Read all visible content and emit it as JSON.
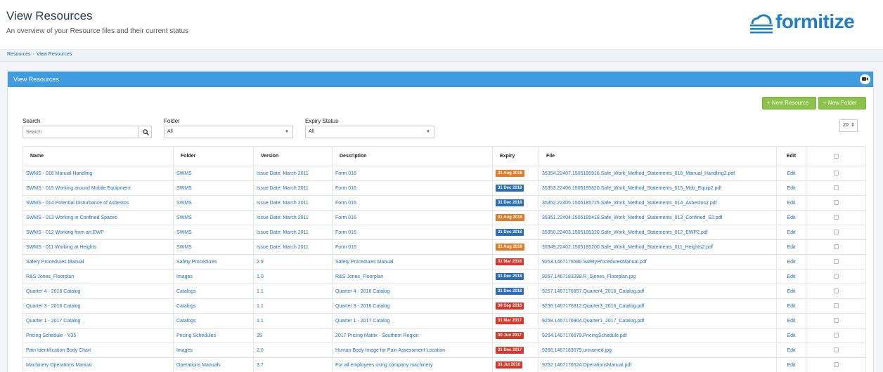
{
  "header": {
    "title": "View Resources",
    "subtitle": "An overview of your Resource files and their current status",
    "logo_text": "formitize"
  },
  "breadcrumb": [
    "Resources",
    "View Resources"
  ],
  "panel": {
    "title": "View Resources",
    "new_resource_label": "+ New Resource",
    "new_folder_label": "+ New Folder"
  },
  "filters": {
    "search_label": "Search",
    "search_placeholder": "Search",
    "folder_label": "Folder",
    "folder_value": "All",
    "expiry_label": "Expiry Status",
    "expiry_value": "All",
    "per_page": "20"
  },
  "colors": {
    "accent": "#3f9ce0",
    "green": "#8bc34a",
    "badge_blue": "#2a6ebb",
    "badge_orange": "#e07b28",
    "badge_red": "#d9372a"
  },
  "table": {
    "columns": [
      "Name",
      "Folder",
      "Version",
      "Description",
      "Expiry",
      "File",
      "Edit"
    ],
    "rows": [
      {
        "name": "SWMS - 016 Manual Handling",
        "folder": "SWMS",
        "version": "Issue Date: March 2011",
        "description": "Form 016",
        "expiry": "31 Aug 2018",
        "status": "orange",
        "file": "35354.22407.1505185916.Safe_Work_Method_Statements_016_Manual_Handling2.pdf",
        "edit": "Edit"
      },
      {
        "name": "SWMS - 015 Working around Mobile Equipment",
        "folder": "SWMS",
        "version": "Issue Date: March 2011",
        "description": "Form 016",
        "expiry": "31 Dec 2018",
        "status": "blue",
        "file": "35353.22406.1505185820.Safe_Work_Method_Statements_015_Mob_Equip2.pdf",
        "edit": "Edit"
      },
      {
        "name": "SWMS - 014 Potential Disturbance of Asbestos",
        "folder": "SWMS",
        "version": "Issue Date: March 2011",
        "description": "Form 016",
        "expiry": "31 Dec 2018",
        "status": "blue",
        "file": "35352.22405.1505185725.Safe_Work_Method_Statements_014_Asbestos2.pdf",
        "edit": "Edit"
      },
      {
        "name": "SWMS - 013 Working in Confined Spaces",
        "folder": "SWMS",
        "version": "Issue Date: March 2011",
        "description": "Form 016",
        "expiry": "31 Aug 2018",
        "status": "orange",
        "file": "35351.22404.1505185418.Safe_Work_Method_Statements_013_Confined_S2.pdf",
        "edit": "Edit"
      },
      {
        "name": "SWMS - 012 Working from an EWP",
        "folder": "SWMS",
        "version": "Issue Date: March 2011",
        "description": "Form 016",
        "expiry": "31 Dec 2018",
        "status": "blue",
        "file": "35350.22403.1505185320.Safe_Work_Method_Statements_012_EWP2.pdf",
        "edit": "Edit"
      },
      {
        "name": "SWMS - 011 Working at Heights",
        "folder": "SWMS",
        "version": "Issue Date: March 2011",
        "description": "Form 016",
        "expiry": "31 Aug 2018",
        "status": "orange",
        "file": "35349.22402.1505185200.Safe_Work_Method_Statements_011_Heights2.pdf",
        "edit": "Edit"
      },
      {
        "name": "Safety Procedures Manual",
        "folder": "Safety Procedures",
        "version": "2.9",
        "description": "Safety Procedures Manual",
        "expiry": "31 Mar 2018",
        "status": "red",
        "file": "9253.1467176580.SafetyProceduresManual.pdf",
        "edit": "Edit"
      },
      {
        "name": "R&S Jones_Floorplan",
        "folder": "Images",
        "version": "1.0",
        "description": "R&S Jones_Floorplan",
        "expiry": "31 Dec 2018",
        "status": "blue",
        "file": "9267.1467183299.R_Sjones_Floorplan.jpg",
        "edit": "Edit"
      },
      {
        "name": "Quarter 4 - 2016 Catalog",
        "folder": "Catalogs",
        "version": "1.1",
        "description": "Quarter 4 - 2016 Catalog",
        "expiry": "31 Dec 2018",
        "status": "blue",
        "file": "9257.1467176857.Quarter4_2016_Catalog.pdf",
        "edit": "Edit"
      },
      {
        "name": "Quarter 3 - 2016 Catalog",
        "folder": "Catalogs",
        "version": "1.1",
        "description": "Quarter 3 - 2016 Catalog",
        "expiry": "30 Sep 2016",
        "status": "red",
        "file": "9256.1467176812.Quarter3_2016_Catalog.pdf",
        "edit": "Edit"
      },
      {
        "name": "Quarter 1 - 2017 Catalog",
        "folder": "Catalogs",
        "version": "1.1",
        "description": "Quarter 1 - 2017 Catalog",
        "expiry": "31 Mar 2017",
        "status": "red",
        "file": "9258.1467176904.Quarter1_2017_Catalog.pdf",
        "edit": "Edit"
      },
      {
        "name": "Pricing Schedule - V35",
        "folder": "Pricing Schedules",
        "version": "35",
        "description": "2017 Pricing Matrix - Southern Region",
        "expiry": "30 Jun 2017",
        "status": "red",
        "file": "9254.1467176679.PricingSchedule.pdf",
        "edit": "Edit"
      },
      {
        "name": "Pain Identification Body Chart",
        "folder": "Images",
        "version": "2.0",
        "description": "Human Body Image for Pain Assessment Location",
        "expiry": "31 Dec 2017",
        "status": "red",
        "file": "9266.1467183079.unnamed.jpg",
        "edit": "Edit"
      },
      {
        "name": "Machinery Operations Manual",
        "folder": "Operations Manuals",
        "version": "3.7",
        "description": "For all employees using company machinery",
        "expiry": "31 Jul 2016",
        "status": "red",
        "file": "9252.1467176524.OperationsManual.pdf",
        "edit": "Edit"
      }
    ]
  }
}
